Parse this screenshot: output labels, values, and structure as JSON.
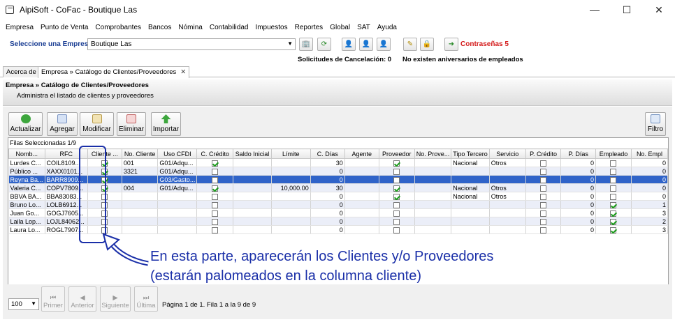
{
  "window": {
    "title": "AipiSoft - CoFac - Boutique Las"
  },
  "menu": [
    {
      "label": "Empresa"
    },
    {
      "label": "Punto de Venta"
    },
    {
      "label": "Comprobantes"
    },
    {
      "label": "Bancos"
    },
    {
      "label": "Nómina"
    },
    {
      "label": "Contabilidad"
    },
    {
      "label": "Impuestos"
    },
    {
      "label": "Reportes"
    },
    {
      "label": "Global"
    },
    {
      "label": "SAT"
    },
    {
      "label": "Ayuda"
    }
  ],
  "company_bar": {
    "label": "Seleccione una Empresa",
    "selected": "Boutique Las",
    "contrasenas": "Contraseñas 5",
    "solicitudes": "Solicitudes de Cancelación: 0",
    "aniversarios": "No existen aniversarios de empleados"
  },
  "tabs": [
    {
      "label": "Acerca de"
    },
    {
      "label": "Empresa » Catálogo de Clientes/Proveedores"
    }
  ],
  "panel": {
    "title": "Empresa » Catálogo de Clientes/Proveedores",
    "subtitle": "Administra el listado de clientes y proveedores"
  },
  "actions": {
    "actualizar": "Actualizar",
    "agregar": "Agregar",
    "modificar": "Modificar",
    "eliminar": "Eliminar",
    "importar": "Importar",
    "filtro": "Filtro"
  },
  "grid": {
    "selected_rows": "Filas Seleccionadas  1/9",
    "columns": [
      "Nomb...",
      "RFC",
      "Cliente ...",
      "No. Cliente",
      "Uso CFDI",
      "C. Crédito",
      "Saldo Inicial",
      "Límite",
      "C. Días",
      "Agente",
      "Proveedor",
      "No. Prove...",
      "Tipo Tercero",
      "Servicio",
      "P. Crédito",
      "P. Días",
      "Empleado",
      "No. Empl"
    ],
    "rows": [
      {
        "nombre": "Lurdes C...",
        "rfc": "COIL8109...",
        "cliente": true,
        "no_cliente": "001",
        "uso_cfdi": "G01/Adqu...",
        "c_credito": true,
        "saldo": "",
        "limite": "",
        "c_dias": "30",
        "agente": "",
        "proveedor": true,
        "no_prov": "",
        "tipo_tercero": "Nacional",
        "servicio": "Otros",
        "p_credito": false,
        "p_dias": "0",
        "empleado": false,
        "no_empl": "0"
      },
      {
        "nombre": "Público ...",
        "rfc": "XAXX0101...",
        "cliente": true,
        "no_cliente": "3321",
        "uso_cfdi": "G01/Adqu...",
        "c_credito": false,
        "saldo": "",
        "limite": "",
        "c_dias": "0",
        "agente": "",
        "proveedor": false,
        "no_prov": "",
        "tipo_tercero": "",
        "servicio": "",
        "p_credito": false,
        "p_dias": "0",
        "empleado": false,
        "no_empl": "0"
      },
      {
        "nombre": "Reyna Ba...",
        "rfc": "BARR8909...",
        "cliente": true,
        "no_cliente": "",
        "uso_cfdi": "G03/Gasto...",
        "c_credito": false,
        "saldo": "",
        "limite": "",
        "c_dias": "0",
        "agente": "",
        "proveedor": false,
        "no_prov": "",
        "tipo_tercero": "",
        "servicio": "",
        "p_credito": false,
        "p_dias": "0",
        "empleado": false,
        "no_empl": "0"
      },
      {
        "nombre": "Valeria C...",
        "rfc": "COPV7809...",
        "cliente": true,
        "no_cliente": "004",
        "uso_cfdi": "G01/Adqu...",
        "c_credito": true,
        "saldo": "",
        "limite": "10,000.00",
        "c_dias": "30",
        "agente": "",
        "proveedor": true,
        "no_prov": "",
        "tipo_tercero": "Nacional",
        "servicio": "Otros",
        "p_credito": false,
        "p_dias": "0",
        "empleado": false,
        "no_empl": "0"
      },
      {
        "nombre": "BBVA BA...",
        "rfc": "BBA83083...",
        "cliente": false,
        "no_cliente": "",
        "uso_cfdi": "",
        "c_credito": false,
        "saldo": "",
        "limite": "",
        "c_dias": "0",
        "agente": "",
        "proveedor": true,
        "no_prov": "",
        "tipo_tercero": "Nacional",
        "servicio": "Otros",
        "p_credito": false,
        "p_dias": "0",
        "empleado": false,
        "no_empl": "0"
      },
      {
        "nombre": "Bruno Lo...",
        "rfc": "LOLB6912...",
        "cliente": false,
        "no_cliente": "",
        "uso_cfdi": "",
        "c_credito": false,
        "saldo": "",
        "limite": "",
        "c_dias": "0",
        "agente": "",
        "proveedor": false,
        "no_prov": "",
        "tipo_tercero": "",
        "servicio": "",
        "p_credito": false,
        "p_dias": "0",
        "empleado": true,
        "no_empl": "1"
      },
      {
        "nombre": "Juan Go...",
        "rfc": "GOGJ7605...",
        "cliente": false,
        "no_cliente": "",
        "uso_cfdi": "",
        "c_credito": false,
        "saldo": "",
        "limite": "",
        "c_dias": "0",
        "agente": "",
        "proveedor": false,
        "no_prov": "",
        "tipo_tercero": "",
        "servicio": "",
        "p_credito": false,
        "p_dias": "0",
        "empleado": true,
        "no_empl": "3"
      },
      {
        "nombre": "Laila Lop...",
        "rfc": "LOJL84062...",
        "cliente": false,
        "no_cliente": "",
        "uso_cfdi": "",
        "c_credito": false,
        "saldo": "",
        "limite": "",
        "c_dias": "0",
        "agente": "",
        "proveedor": false,
        "no_prov": "",
        "tipo_tercero": "",
        "servicio": "",
        "p_credito": false,
        "p_dias": "0",
        "empleado": true,
        "no_empl": "2"
      },
      {
        "nombre": "Laura Lo...",
        "rfc": "ROGL7907...",
        "cliente": false,
        "no_cliente": "",
        "uso_cfdi": "",
        "c_credito": false,
        "saldo": "",
        "limite": "",
        "c_dias": "0",
        "agente": "",
        "proveedor": false,
        "no_prov": "",
        "tipo_tercero": "",
        "servicio": "",
        "p_credito": false,
        "p_dias": "0",
        "empleado": true,
        "no_empl": "3"
      }
    ]
  },
  "annotation": {
    "line1": "En esta parte, aparecerán los Clientes y/o Proveedores",
    "line2": "(estarán palomeados en la columna cliente)"
  },
  "pager": {
    "page_size": "100",
    "primer": "Primer",
    "anterior": "Anterior",
    "siguiente": "Siguiente",
    "ultima": "Última",
    "info": "Página 1 de 1. Fila 1 a la 9 de 9"
  },
  "colors": {
    "accent": "#1c3f94",
    "selection": "#2f63c9",
    "alert": "#d41b1b",
    "annotation": "#1a2fa8"
  }
}
